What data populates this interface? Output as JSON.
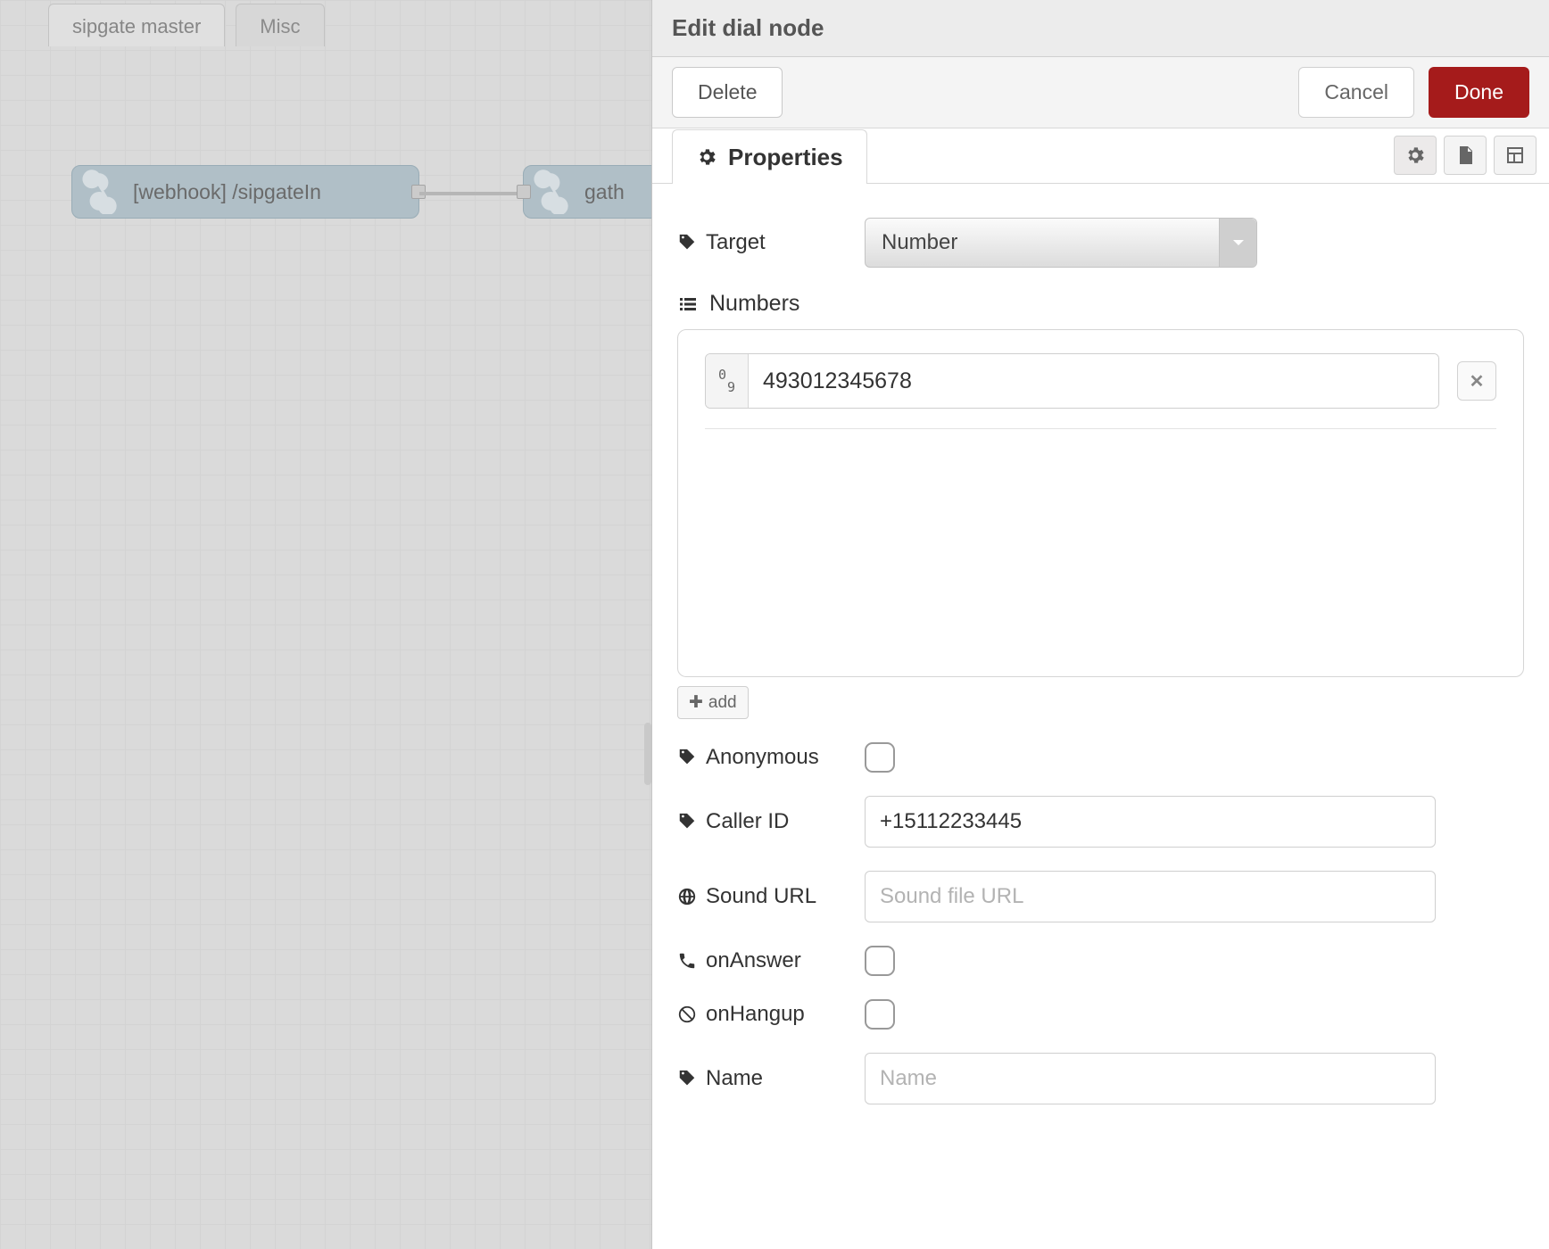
{
  "canvas": {
    "tabs": [
      "sipgate master",
      "Misc"
    ],
    "active_tab_index": 0,
    "nodes": {
      "webhook": {
        "label": "[webhook] /sipgateIn"
      },
      "gather": {
        "label": "gath"
      }
    }
  },
  "panel": {
    "title": "Edit dial node",
    "delete_label": "Delete",
    "cancel_label": "Cancel",
    "done_label": "Done",
    "tab_properties": "Properties",
    "fields": {
      "target_label": "Target",
      "target_value": "Number",
      "numbers_label": "Numbers",
      "numbers": [
        "493012345678"
      ],
      "add_label": "add",
      "anonymous_label": "Anonymous",
      "anonymous_checked": false,
      "caller_id_label": "Caller ID",
      "caller_id_value": "+15112233445",
      "sound_url_label": "Sound URL",
      "sound_url_placeholder": "Sound file URL",
      "onanswer_label": "onAnswer",
      "onanswer_checked": false,
      "onhangup_label": "onHangup",
      "onhangup_checked": false,
      "name_label": "Name",
      "name_placeholder": "Name"
    }
  }
}
